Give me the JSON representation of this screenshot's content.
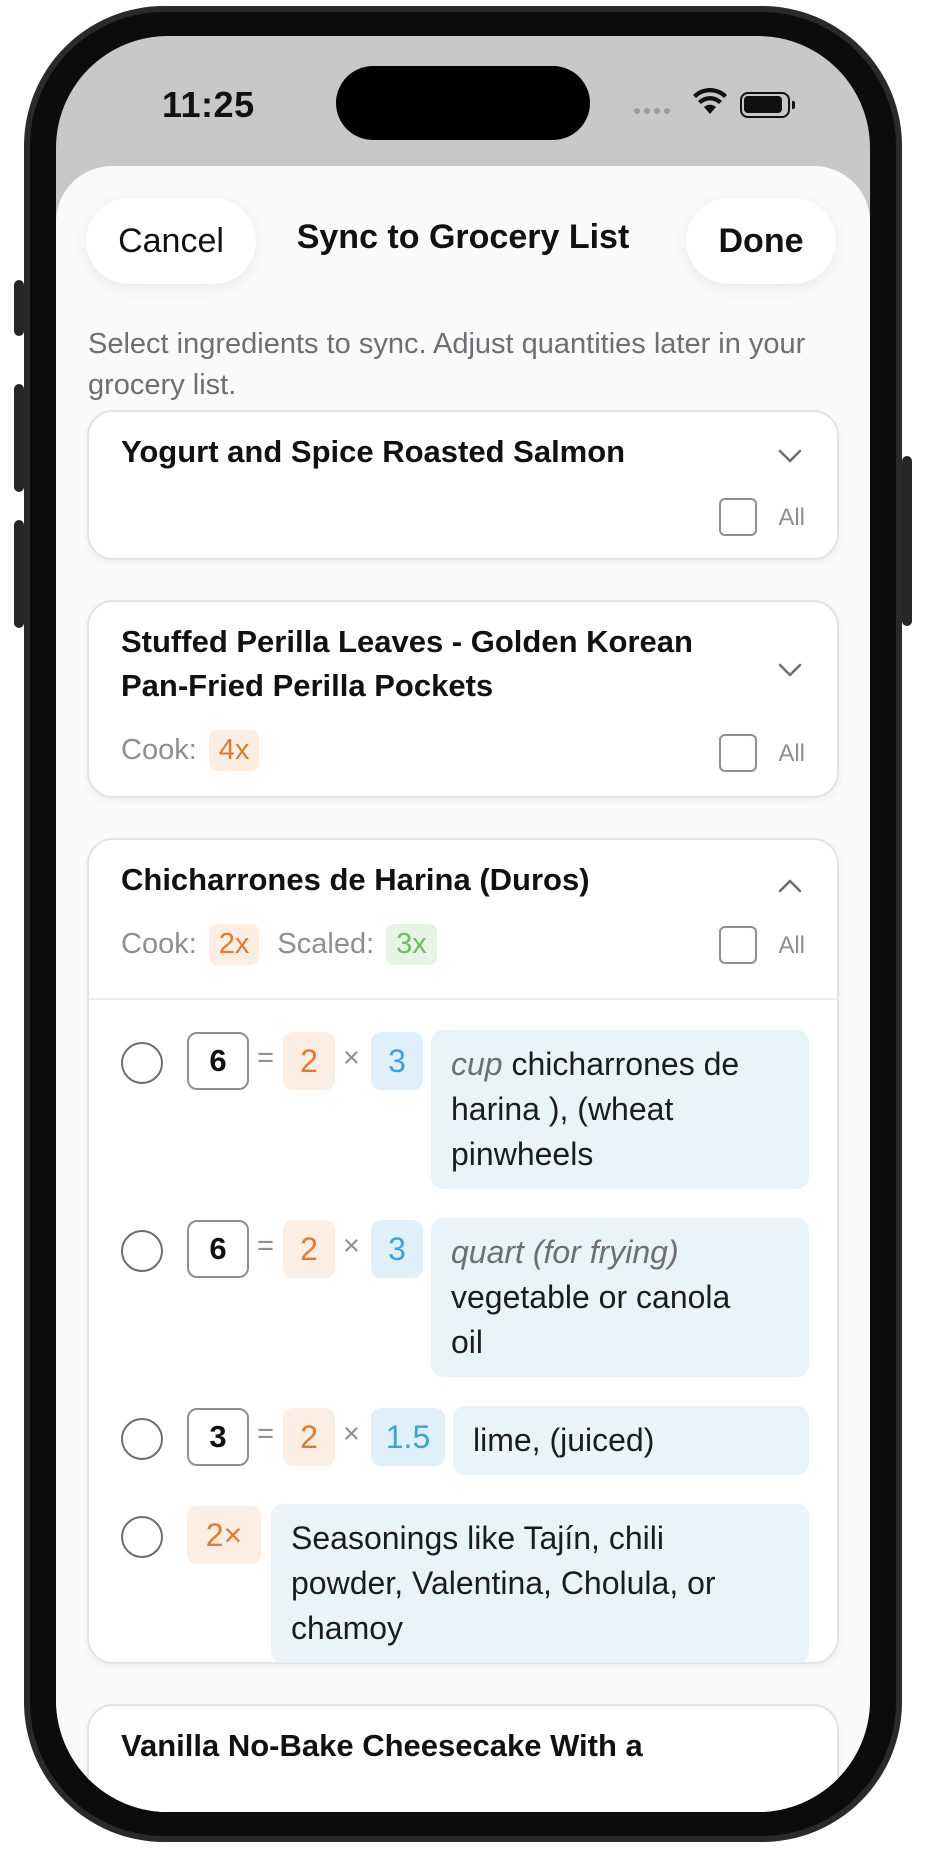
{
  "status": {
    "time": "11:25"
  },
  "sheet": {
    "cancel_label": "Cancel",
    "title": "Sync to Grocery List",
    "done_label": "Done",
    "subtitle": "Select ingredients to sync. Adjust quantities later in your grocery list."
  },
  "recipes": [
    {
      "title": "Yogurt and Spice Roasted Salmon",
      "all_label": "All",
      "expanded": false
    },
    {
      "title_line1": "Stuffed Perilla Leaves - Golden Korean",
      "title_line2": "Pan-Fried Perilla Pockets",
      "cook_label": "Cook:",
      "cook_mult": "4x",
      "all_label": "All",
      "expanded": false
    },
    {
      "title": "Chicharrones de Harina (Duros)",
      "cook_label": "Cook:",
      "cook_mult": "2x",
      "scaled_label": "Scaled:",
      "scaled_mult": "3x",
      "all_label": "All",
      "expanded": true,
      "ingredients": [
        {
          "qty": "6",
          "eq": "=",
          "mult": "2",
          "times": "×",
          "scale": "3",
          "unit": "cup",
          "line1_rest": "chicharrones de",
          "line2": "harina ), (wheat",
          "line3": "pinwheels"
        },
        {
          "qty": "6",
          "eq": "=",
          "mult": "2",
          "times": "×",
          "scale": "3",
          "unit": "quart (for frying)",
          "line2": "vegetable or canola",
          "line3": "oil"
        },
        {
          "qty": "3",
          "eq": "=",
          "mult": "2",
          "times": "×",
          "scale": "1.5",
          "text": "lime, (juiced)"
        },
        {
          "mult": "2×",
          "line1": "Seasonings like Tajín, chili",
          "line2": "powder, Valentina, Cholula, or",
          "line3": "chamoy"
        }
      ]
    },
    {
      "title": "Vanilla No-Bake Cheesecake With a"
    }
  ]
}
